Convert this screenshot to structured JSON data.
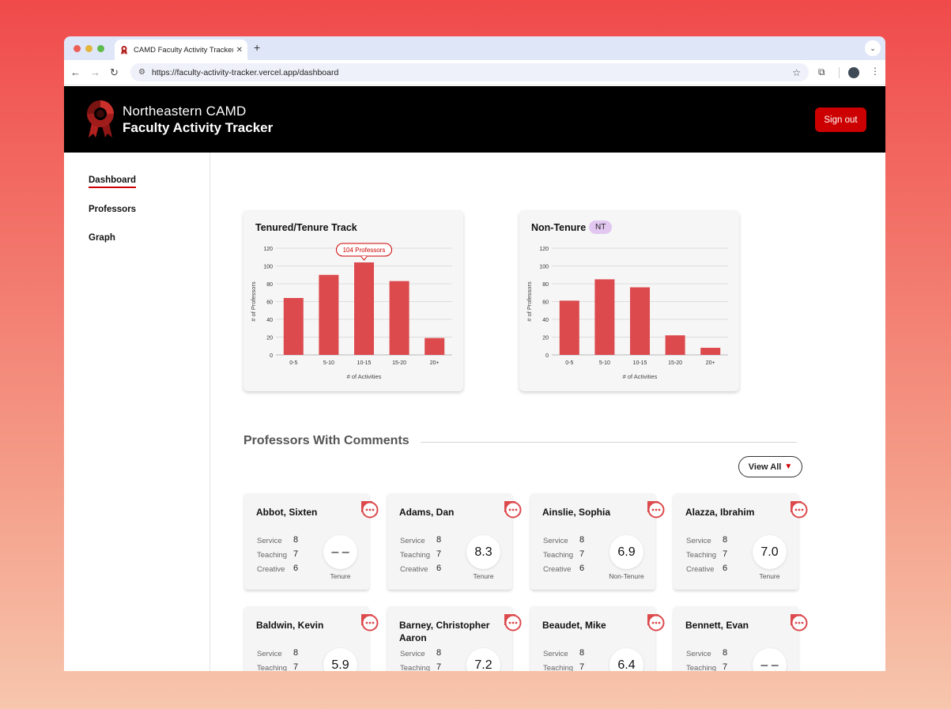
{
  "browser": {
    "tab_title": "CAMD Faculty Activity Tracker",
    "url": "https://faculty-activity-tracker.vercel.app/dashboard"
  },
  "header": {
    "line1": "Northeastern CAMD",
    "line2": "Faculty Activity Tracker",
    "signout_label": "Sign out"
  },
  "sidebar": {
    "items": [
      {
        "label": "Dashboard",
        "active": true
      },
      {
        "label": "Professors",
        "active": false
      },
      {
        "label": "Graph",
        "active": false
      }
    ]
  },
  "charts": {
    "tenured_title": "Tenured/Tenure Track",
    "nontenure_title": "Non-Tenure",
    "nontenure_badge": "NT",
    "tooltip": "104 Professors"
  },
  "chart_data": [
    {
      "type": "bar",
      "title": "Tenured/Tenure Track",
      "categories": [
        "0-5",
        "5-10",
        "10-15",
        "15-20",
        "20+"
      ],
      "values": [
        64,
        90,
        104,
        83,
        19
      ],
      "xlabel": "# of Activities",
      "ylabel": "# of Professors",
      "ylim": [
        0,
        120
      ],
      "yticks": [
        0,
        20,
        40,
        60,
        80,
        100,
        120
      ],
      "grid": true,
      "color": "#dc4a4d"
    },
    {
      "type": "bar",
      "title": "Non-Tenure",
      "categories": [
        "0-5",
        "5-10",
        "10-15",
        "15-20",
        "20+"
      ],
      "values": [
        61,
        85,
        76,
        22,
        8
      ],
      "xlabel": "# of Activities",
      "ylabel": "# of Professors",
      "ylim": [
        0,
        120
      ],
      "yticks": [
        0,
        20,
        40,
        60,
        80,
        100,
        120
      ],
      "grid": true,
      "color": "#dc4a4d"
    }
  ],
  "comments_section": {
    "title": "Professors With Comments",
    "view_all_label": "View All"
  },
  "stat_labels": {
    "service": "Service",
    "teaching": "Teaching",
    "creative": "Creative"
  },
  "professors": [
    {
      "name": "Abbot, Sixten",
      "service": "8",
      "teaching": "7",
      "creative": "6",
      "score": "– –",
      "type": "Tenure"
    },
    {
      "name": "Adams, Dan",
      "service": "8",
      "teaching": "7",
      "creative": "6",
      "score": "8.3",
      "type": "Tenure"
    },
    {
      "name": "Ainslie, Sophia",
      "service": "8",
      "teaching": "7",
      "creative": "6",
      "score": "6.9",
      "type": "Non-Tenure"
    },
    {
      "name": "Alazza, Ibrahim",
      "service": "8",
      "teaching": "7",
      "creative": "6",
      "score": "7.0",
      "type": "Tenure"
    },
    {
      "name": "Baldwin, Kevin",
      "service": "8",
      "teaching": "7",
      "creative": "",
      "score": "5.9",
      "type": ""
    },
    {
      "name": "Barney, Christopher Aaron",
      "service": "8",
      "teaching": "7",
      "creative": "",
      "score": "7.2",
      "type": ""
    },
    {
      "name": "Beaudet, Mike",
      "service": "8",
      "teaching": "7",
      "creative": "",
      "score": "6.4",
      "type": ""
    },
    {
      "name": "Bennett, Evan",
      "service": "8",
      "teaching": "7",
      "creative": "",
      "score": "– –",
      "type": ""
    }
  ],
  "colors": {
    "accent": "#cc0000",
    "bar": "#dc4a4d",
    "header_bg": "#000000"
  }
}
